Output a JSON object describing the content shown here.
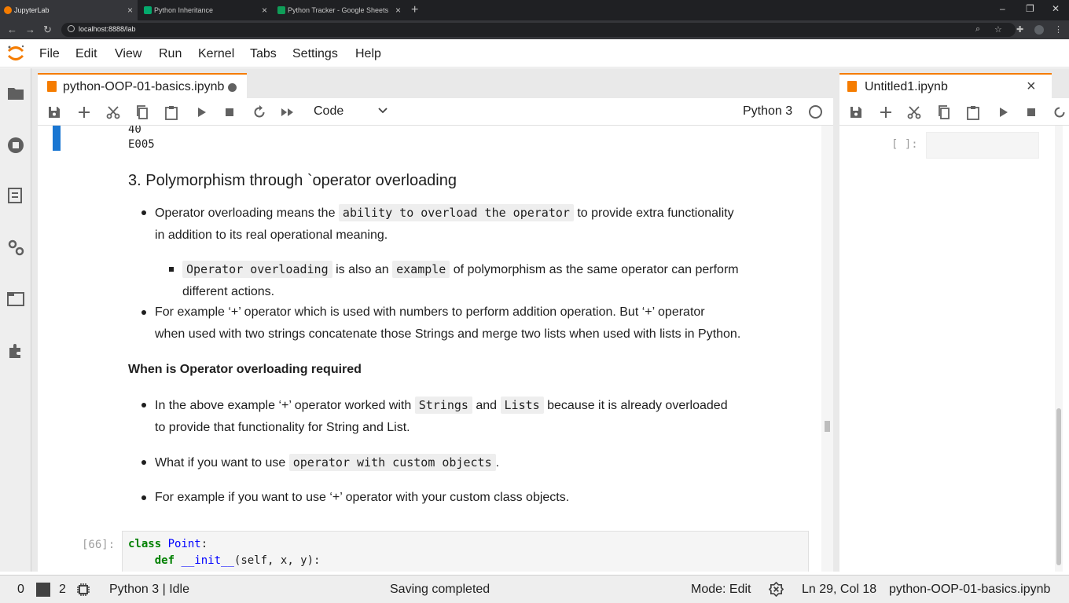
{
  "browser": {
    "tabs": [
      {
        "title": "JupyterLab",
        "active": true
      },
      {
        "title": "Python Inheritance",
        "active": false
      },
      {
        "title": "Python Tracker - Google Sheets",
        "active": false
      }
    ],
    "url": "localhost:8888/lab"
  },
  "menu": [
    "File",
    "Edit",
    "View",
    "Run",
    "Kernel",
    "Tabs",
    "Settings",
    "Help"
  ],
  "main_panel": {
    "tab_title": "python-OOP-01-basics.ipynb",
    "cell_type": "Code",
    "kernel": "Python 3",
    "output_lines": [
      "40",
      "E005"
    ],
    "heading": "3. Polymorphism through `operator overloading",
    "bullet1_a": "Operator overloading means the ",
    "bullet1_code": "ability to overload the operator",
    "bullet1_b": " to provide extra functionality",
    "bullet1_c": "in addition to its real operational meaning.",
    "sub1_code1": "Operator overloading",
    "sub1_a": " is also an ",
    "sub1_code2": "example",
    "sub1_b": " of polymorphism as the same operator can perform",
    "sub1_c": "different actions.",
    "bullet2_a": "For example ‘+’ operator which is used with numbers to perform addition operation. But ‘+’ operator",
    "bullet2_b": "when used with two strings concatenate those Strings and merge two lists when used with lists in Python.",
    "heading2": "When is Operator overloading required",
    "bullet3_a": "In the above example ‘+’ operator worked with ",
    "bullet3_code1": "Strings",
    "bullet3_mid": " and ",
    "bullet3_code2": "Lists",
    "bullet3_b": " because it is already overloaded",
    "bullet3_c": "to provide that functionality for String and List.",
    "bullet4_a": "What if you want to use ",
    "bullet4_code": "operator with custom objects",
    "bullet4_b": ".",
    "bullet5": "For example if you want to use ‘+’ operator with your custom class objects.",
    "code_prompt": "[66]:",
    "code_line1_kw": "class",
    "code_line1_name": "Point",
    "code_line1_rest": ":",
    "code_line2_kw": "def",
    "code_line2_name": "__init__",
    "code_line2_rest": "(self, x, y):"
  },
  "right_panel": {
    "tab_title": "Untitled1.ipynb",
    "prompt": "[ ]:"
  },
  "status": {
    "terminals": "0",
    "kernels": "2",
    "kernel_state": "Python 3 | Idle",
    "message": "Saving completed",
    "mode": "Mode: Edit",
    "position": "Ln 29, Col 18",
    "file": "python-OOP-01-basics.ipynb"
  },
  "colors": {
    "accent": "#f57c00",
    "active_cell": "#1976d2"
  }
}
